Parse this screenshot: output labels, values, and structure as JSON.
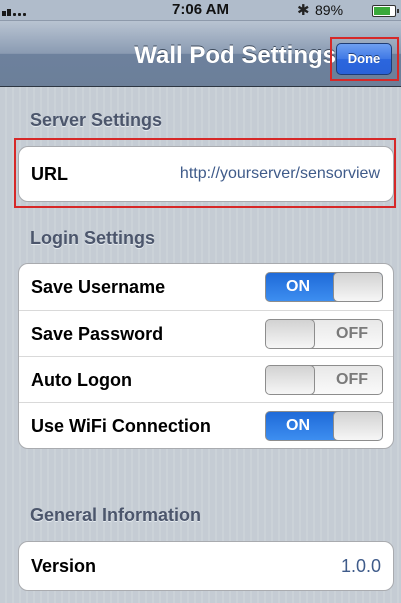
{
  "status_bar": {
    "time": "7:06 AM",
    "battery_percent": "89%",
    "battery_level": 0.89,
    "bluetooth_icon": "bluetooth-icon"
  },
  "nav": {
    "title": "Wall Pod Settings",
    "done_label": "Done"
  },
  "sections": {
    "server": {
      "header": "Server Settings",
      "url_label": "URL",
      "url_value": "http://yourserver/sensorview"
    },
    "login": {
      "header": "Login Settings",
      "rows": [
        {
          "label": "Save Username",
          "state": "ON"
        },
        {
          "label": "Save Password",
          "state": "OFF"
        },
        {
          "label": "Auto Logon",
          "state": "OFF"
        },
        {
          "label": "Use WiFi Connection",
          "state": "ON"
        }
      ]
    },
    "general": {
      "header": "General Information",
      "version_label": "Version",
      "version_value": "1.0.0"
    }
  },
  "colors": {
    "highlight": "#d62828",
    "switch_on": "#2f7fe8",
    "value_text": "#3f5b8a"
  }
}
